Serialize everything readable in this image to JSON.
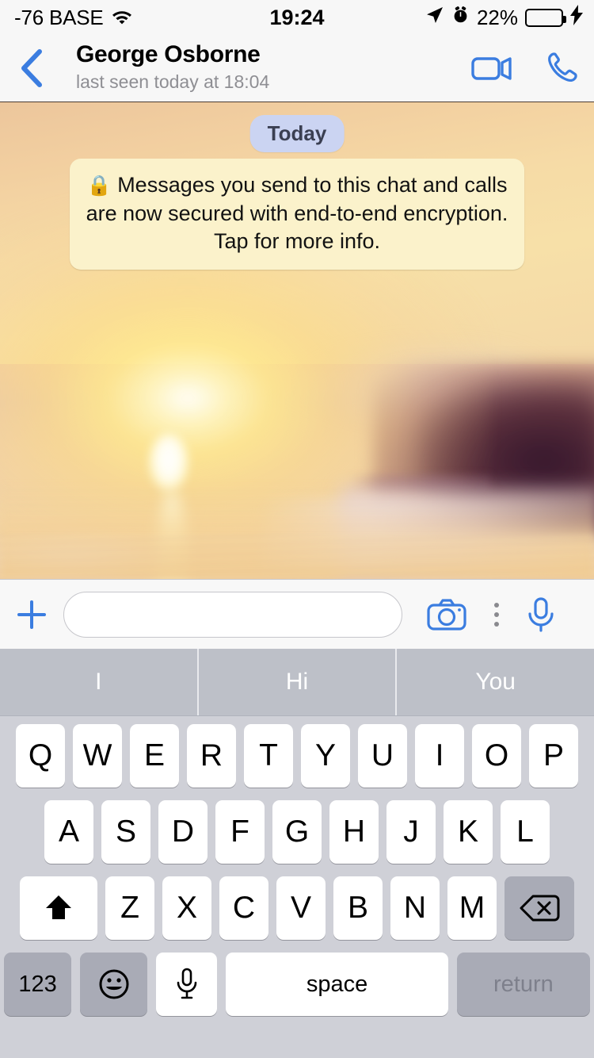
{
  "status_bar": {
    "carrier": "-76 BASE",
    "wifi_icon": "wifi-icon",
    "time": "19:24",
    "location_icon": "location-arrow-icon",
    "alarm_icon": "alarm-clock-icon",
    "battery_percent": "22%",
    "battery_level": 22,
    "battery_color": "#4CD964",
    "charging_icon": "lightning-bolt-icon"
  },
  "nav_bar": {
    "back_icon": "chevron-left-icon",
    "contact_name": "George Osborne",
    "presence": "last seen today at 18:04",
    "video_call_icon": "video-camera-icon",
    "voice_call_icon": "phone-icon",
    "accent_color": "#3B7DE0"
  },
  "chat": {
    "date_badge": "Today",
    "date_badge_bg": "#CBD4F2",
    "system_message": {
      "lock_icon": "lock-icon",
      "text": "Messages you send to this chat and calls are now secured with end-to-end encryption. Tap for more info.",
      "bubble_bg": "#FBF2CB"
    },
    "wallpaper": "blurred-sunset-beach-photo"
  },
  "input_bar": {
    "attach_icon": "plus-icon",
    "message_value": "",
    "message_placeholder": "",
    "camera_icon": "camera-icon",
    "more_icon": "kebab-menu-icon",
    "mic_icon": "microphone-icon"
  },
  "keyboard": {
    "predictions": [
      "I",
      "Hi",
      "You"
    ],
    "row1": [
      "Q",
      "W",
      "E",
      "R",
      "T",
      "Y",
      "U",
      "I",
      "O",
      "P"
    ],
    "row2": [
      "A",
      "S",
      "D",
      "F",
      "G",
      "H",
      "J",
      "K",
      "L"
    ],
    "row3": [
      "Z",
      "X",
      "C",
      "V",
      "B",
      "N",
      "M"
    ],
    "shift_icon": "shift-arrow-icon",
    "backspace_icon": "backspace-delete-icon",
    "numbers_key": "123",
    "emoji_icon": "smiley-face-icon",
    "dictation_icon": "microphone-icon",
    "space_key": "space",
    "return_key": "return",
    "background_color": "#CFD0D7",
    "prediction_bar_color": "#BDC0C8"
  }
}
